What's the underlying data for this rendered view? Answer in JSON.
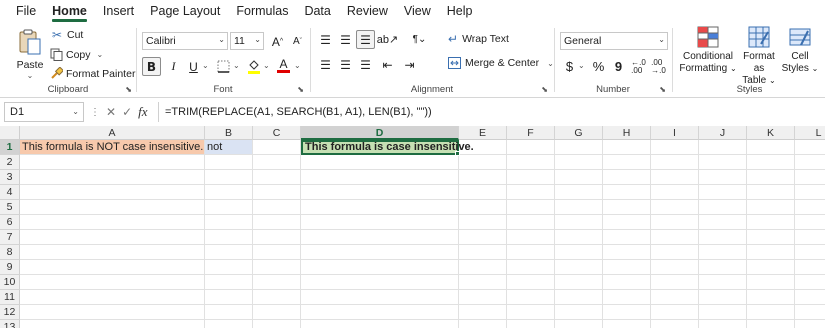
{
  "menu": {
    "tabs": [
      "File",
      "Home",
      "Insert",
      "Page Layout",
      "Formulas",
      "Data",
      "Review",
      "View",
      "Help"
    ],
    "active": "Home"
  },
  "ribbon": {
    "clipboard": {
      "paste": "Paste",
      "cut": "Cut",
      "copy": "Copy",
      "format_painter": "Format Painter",
      "label": "Clipboard"
    },
    "font": {
      "family": "Calibri",
      "size": "11",
      "label": "Font",
      "bold": "B",
      "italic": "I",
      "underline": "U",
      "grow": "A",
      "shrink": "A",
      "font_color_letter": "A",
      "font_color": "#e00000",
      "fill_color": "#ffff00"
    },
    "alignment": {
      "wrap_text": "Wrap Text",
      "merge_center": "Merge & Center",
      "label": "Alignment"
    },
    "number": {
      "format": "General",
      "currency": "$",
      "percent": "%",
      "comma": "9",
      "label": "Number"
    },
    "styles": {
      "conditional_1": "Conditional",
      "conditional_2": "Formatting",
      "format_table_1": "Format as",
      "format_table_2": "Table",
      "cell_styles_1": "Cell",
      "cell_styles_2": "Styles",
      "label": "Styles"
    }
  },
  "formula_bar": {
    "name_box": "D1",
    "fx": "fx",
    "formula": "=TRIM(REPLACE(A1, SEARCH(B1, A1), LEN(B1), \"\"))"
  },
  "sheet": {
    "columns": [
      "A",
      "B",
      "C",
      "D",
      "E",
      "F",
      "G",
      "H",
      "I",
      "J",
      "K",
      "L"
    ],
    "rows": [
      "1",
      "2",
      "3",
      "4",
      "5",
      "6",
      "7",
      "8",
      "9",
      "10",
      "11",
      "12",
      "13"
    ],
    "selected_cell": "D1",
    "cells": {
      "A1": "This formula is NOT case insensitive.",
      "B1": "not",
      "D1": "This formula is case insensitive."
    },
    "colors": {
      "a1_fill": "#f7c9ac",
      "b1_fill": "#dae3f3",
      "d1_fill": "#c6e0b4",
      "accent": "#1e6c41"
    }
  }
}
